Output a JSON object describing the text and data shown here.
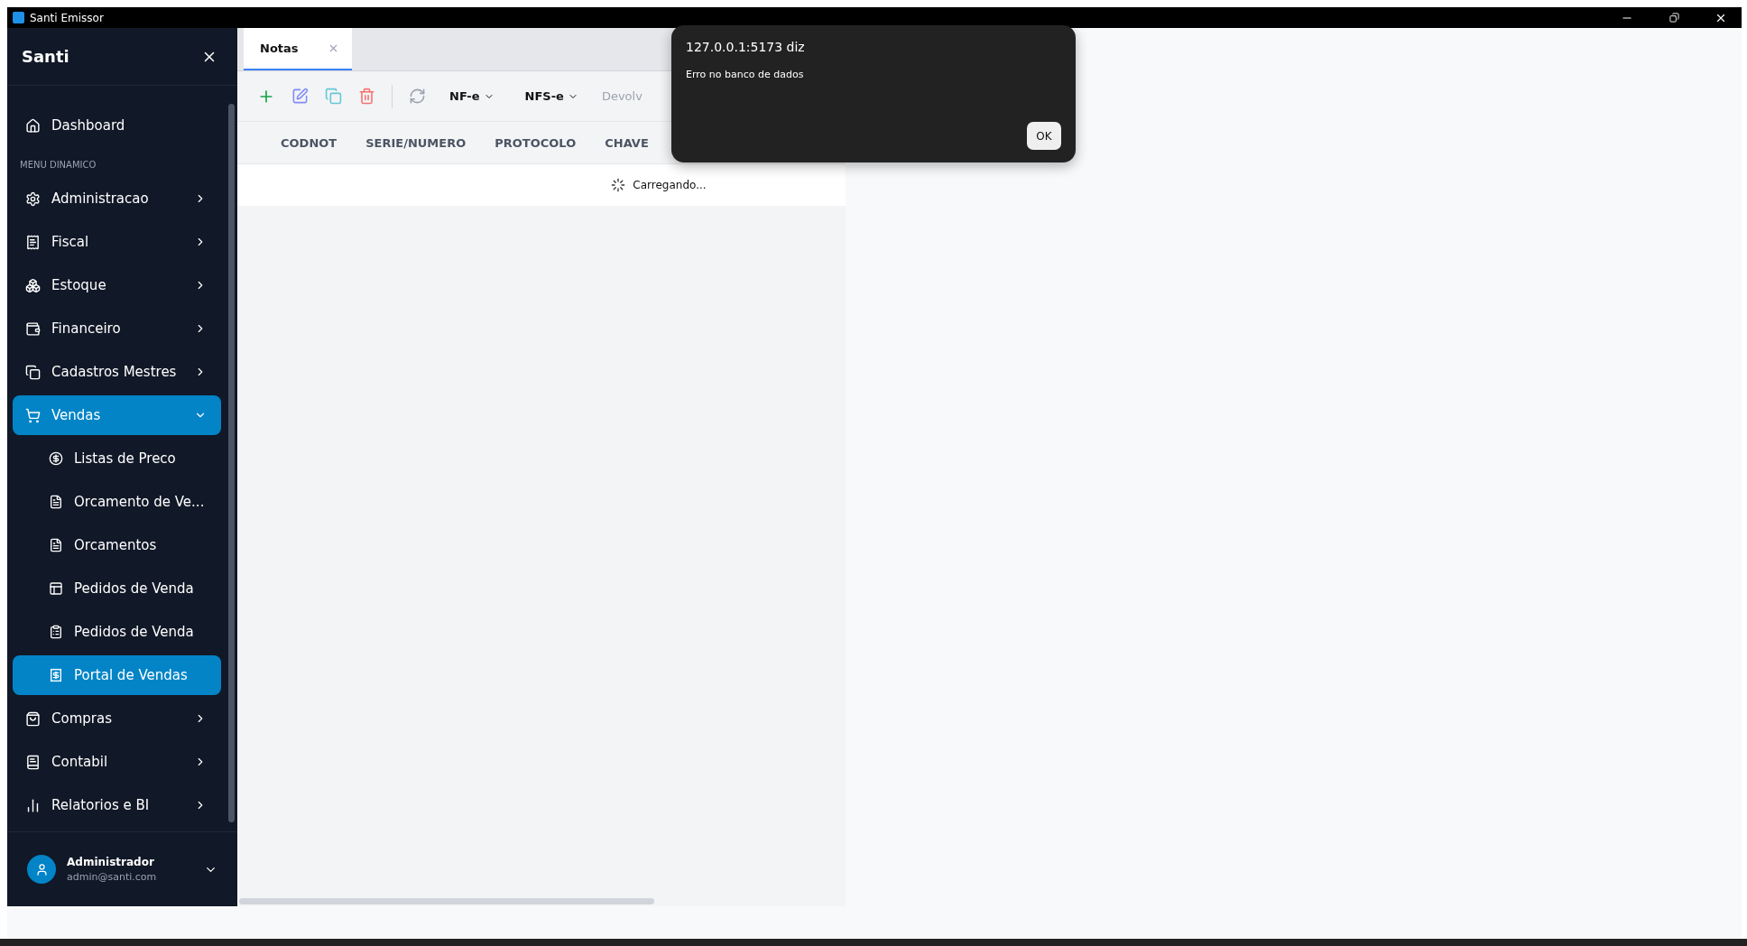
{
  "window": {
    "title": "Santi Emissor"
  },
  "sidebar": {
    "brand": "Santi",
    "items": [
      {
        "kind": "link",
        "label": "Dashboard",
        "selected": false
      },
      {
        "kind": "section",
        "label": "MENU DINAMICO"
      },
      {
        "kind": "group",
        "label": "Administracao",
        "expanded": false,
        "selected": false
      },
      {
        "kind": "group",
        "label": "Fiscal",
        "expanded": false,
        "selected": false
      },
      {
        "kind": "group",
        "label": "Estoque",
        "expanded": false,
        "selected": false
      },
      {
        "kind": "group",
        "label": "Financeiro",
        "expanded": false,
        "selected": false
      },
      {
        "kind": "group",
        "label": "Cadastros Mestres",
        "expanded": false,
        "selected": false
      },
      {
        "kind": "group",
        "label": "Vendas",
        "expanded": true,
        "selected": true,
        "children": [
          {
            "label": "Listas de Preco",
            "selected": false
          },
          {
            "label": "Orcamento de Ve...",
            "selected": false
          },
          {
            "label": "Orcamentos",
            "selected": false
          },
          {
            "label": "Pedidos de Venda",
            "selected": false
          },
          {
            "label": "Pedidos de Venda",
            "selected": false
          },
          {
            "label": "Portal de Vendas",
            "selected": true
          }
        ]
      },
      {
        "kind": "group",
        "label": "Compras",
        "expanded": false,
        "selected": false
      },
      {
        "kind": "group",
        "label": "Contabil",
        "expanded": false,
        "selected": false
      },
      {
        "kind": "group",
        "label": "Relatorios e BI",
        "expanded": false,
        "selected": false
      }
    ],
    "user": {
      "name": "Administrador",
      "email": "admin@santi.com"
    }
  },
  "tabs": [
    {
      "label": "Notas",
      "selected": true
    }
  ],
  "toolbar": {
    "menus": [
      "NF-e",
      "NFS-e"
    ],
    "cut_button": "Devolv"
  },
  "table": {
    "columns": [
      "CODNOT",
      "SERIE/NUMERO",
      "PROTOCOLO",
      "CHAVE"
    ],
    "loading": "Carregando..."
  },
  "dialog": {
    "title": "127.0.0.1:5173 diz",
    "message": "Erro no banco de dados",
    "button": "OK"
  }
}
